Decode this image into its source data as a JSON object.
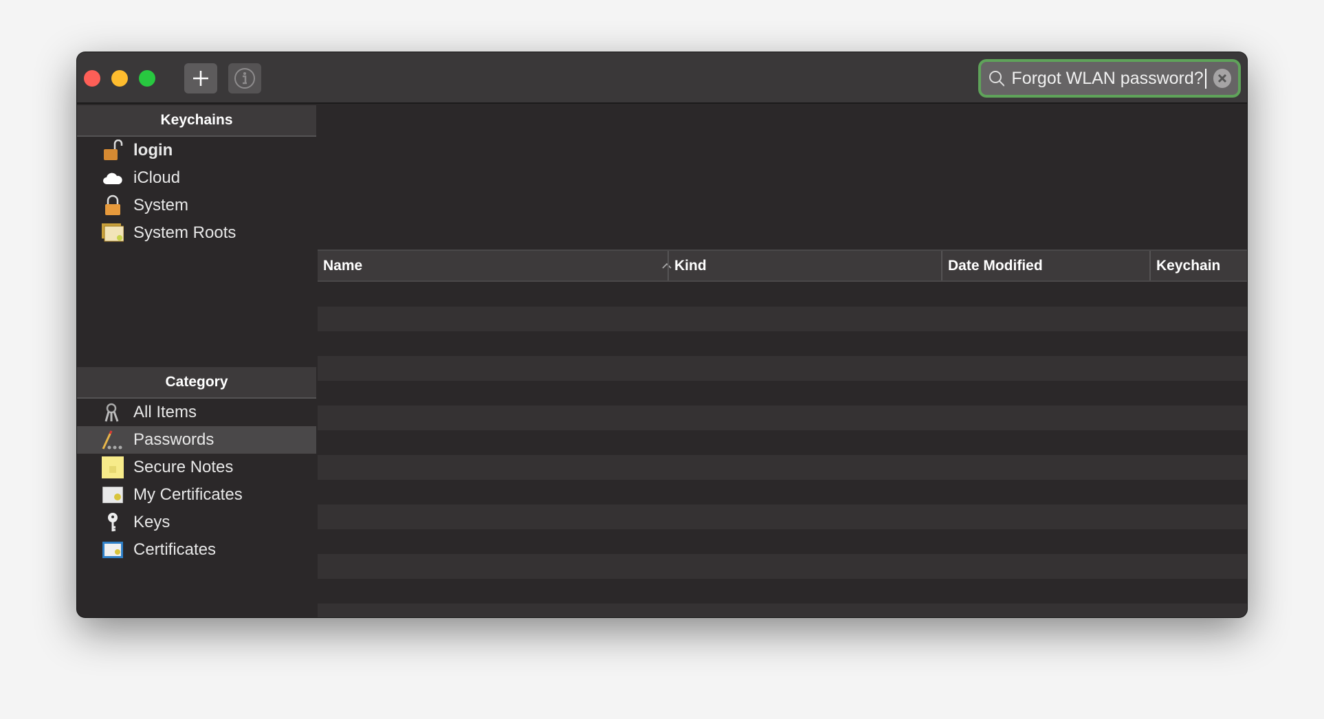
{
  "toolbar": {
    "add_icon": "plus-icon",
    "info_icon": "info-icon"
  },
  "search": {
    "value": "Forgot WLAN password?",
    "accent": "#5fa35a"
  },
  "keychains": {
    "header": "Keychains",
    "items": [
      {
        "label": "login",
        "icon": "unlocked-padlock-icon",
        "bold": true
      },
      {
        "label": "iCloud",
        "icon": "cloud-icon"
      },
      {
        "label": "System",
        "icon": "padlock-icon"
      },
      {
        "label": "System Roots",
        "icon": "certificate-stack-icon"
      }
    ]
  },
  "category": {
    "header": "Category",
    "selected": "Passwords",
    "items": [
      {
        "label": "All Items",
        "icon": "keys-icon"
      },
      {
        "label": "Passwords",
        "icon": "pencil-icon"
      },
      {
        "label": "Secure Notes",
        "icon": "note-icon"
      },
      {
        "label": "My Certificates",
        "icon": "my-certificate-icon"
      },
      {
        "label": "Keys",
        "icon": "key-icon"
      },
      {
        "label": "Certificates",
        "icon": "certificate-icon"
      }
    ]
  },
  "table": {
    "columns": [
      "Name",
      "Kind",
      "Date Modified",
      "Keychain"
    ],
    "sort_column": "Name",
    "sort_direction": "ascending",
    "rows": []
  }
}
